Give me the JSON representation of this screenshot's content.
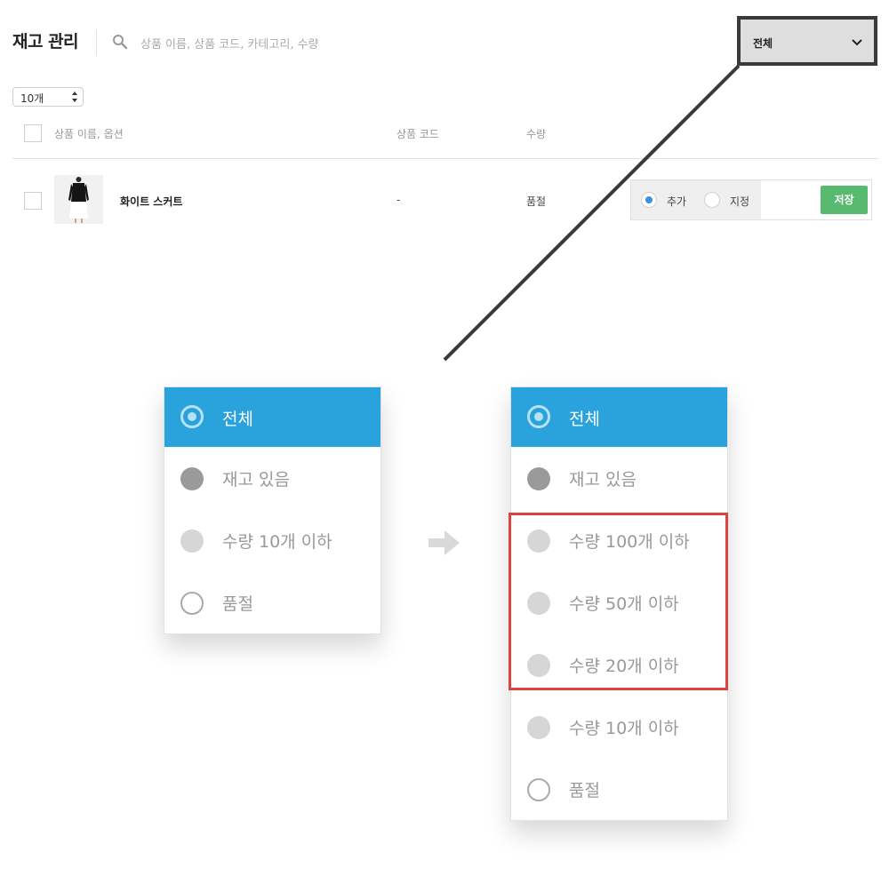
{
  "header": {
    "title": "재고 관리",
    "search_placeholder": "상품 이름, 상품 코드, 카테고리, 수량",
    "filter_value": "전체"
  },
  "page_size": "10개",
  "table": {
    "columns": [
      "상품 이름, 옵션",
      "상품 코드",
      "수량"
    ],
    "rows": [
      {
        "name": "화이트 스커트",
        "code": "-",
        "quantity": "품절",
        "radio_add": "추가",
        "radio_set": "지정",
        "save_label": "저장"
      }
    ]
  },
  "dropdown_before": {
    "options": [
      "전체",
      "재고 있음",
      "수량 10개 이하",
      "품절"
    ]
  },
  "dropdown_after": {
    "options": [
      "전체",
      "재고 있음",
      "수량 100개 이하",
      "수량 50개 이하",
      "수량 20개 이하",
      "수량 10개 이하",
      "품절"
    ]
  },
  "colors": {
    "selected_option": "#2aa3dc",
    "save_button": "#58ba6e",
    "highlight_border": "#d9453d",
    "callout_border": "#3a3a3a"
  }
}
